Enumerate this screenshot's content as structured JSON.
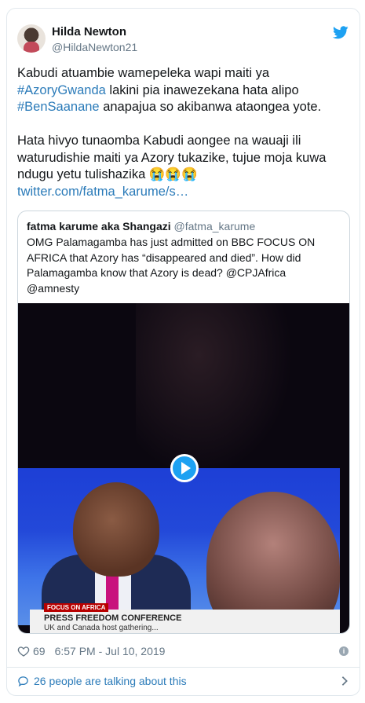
{
  "author": {
    "name": "Hilda Newton",
    "handle": "@HildaNewton21"
  },
  "tweet": {
    "p1_a": "Kabudi atuambie wamepeleka wapi maiti ya ",
    "hashtag1": "#AzoryGwanda",
    "p1_b": " lakini pia inawezekana hata alipo ",
    "hashtag2": "#BenSaanane",
    "p1_c": " anapajua so akibanwa ataongea yote.",
    "p2": "Hata hivyo tunaomba Kabudi aongee na wauaji ili waturudishie maiti ya Azory tukazike, tujue moja kuwa ndugu yetu tulishazika 😭😭😭",
    "link": "twitter.com/fatma_karume/s…"
  },
  "quoted": {
    "name": "fatma karume aka Shangazi",
    "handle": "@fatma_karume",
    "text": "OMG Palamagamba has just admitted on BBC FOCUS ON AFRICA that Azory has “disappeared and died”. How did Palamagamba know that Azory is dead? @CPJAfrica @amnesty",
    "video": {
      "ticker_tag": "FOCUS ON AFRICA",
      "ticker_title": "PRESS FREEDOM CONFERENCE",
      "ticker_sub": "UK and Canada host gathering..."
    }
  },
  "meta": {
    "likes": "69",
    "timestamp": "6:57 PM - Jul 10, 2019"
  },
  "footer": {
    "talking": "26 people are talking about this"
  },
  "colors": {
    "link": "#2b7bb9",
    "twitter_blue": "#1da1f2",
    "muted": "#657786"
  }
}
